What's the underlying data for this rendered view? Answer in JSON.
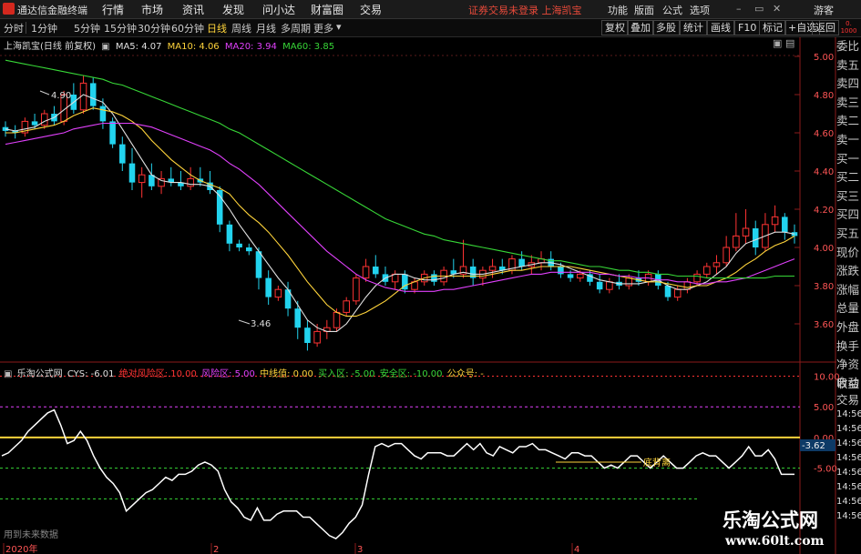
{
  "window": {
    "title": "通达信金融终端"
  },
  "menu": [
    "行情",
    "市场",
    "资讯",
    "发现",
    "问小达",
    "财富圈",
    "交易"
  ],
  "notice": "证券交易未登录  上海凯宝",
  "right_menu": [
    "功能",
    "版面",
    "公式",
    "选项",
    "游客"
  ],
  "toolbar": {
    "periods": [
      "分时",
      "1分钟",
      "5分钟",
      "15分钟",
      "30分钟",
      "60分钟",
      "日线",
      "周线",
      "月线",
      "多周期",
      "更多"
    ],
    "active": "日线",
    "buttons": [
      "复权",
      "叠加",
      "多股",
      "统计",
      "画线",
      "F10",
      "标记",
      "+自选",
      "返回"
    ]
  },
  "main_chart": {
    "title": "上海凯宝(日线 前复权)",
    "ma": [
      {
        "label": "MA5: 4.07",
        "color": "#e0e0e0"
      },
      {
        "label": "MA10: 4.06",
        "color": "#ffd43b"
      },
      {
        "label": "MA20: 3.94",
        "color": "#e040fb"
      },
      {
        "label": "MA60: 3.85",
        "color": "#37d637"
      }
    ],
    "price_labels": [
      "5.00",
      "4.80",
      "4.60",
      "4.40",
      "4.20",
      "4.00",
      "3.80",
      "3.60"
    ],
    "max_marker": "4.90",
    "min_marker": "3.46"
  },
  "indicator": {
    "title": "乐淘公式网",
    "items": [
      {
        "label": "CYS: -6.01",
        "color": "#e0e0e0"
      },
      {
        "label": "绝对风险区: 10.00",
        "color": "#ff3333"
      },
      {
        "label": "风险区: 5.00",
        "color": "#e040fb"
      },
      {
        "label": "中线值: 0.00",
        "color": "#ffd43b"
      },
      {
        "label": "买入区: -5.00",
        "color": "#37d637"
      },
      {
        "label": "安全区: -10.00",
        "color": "#37d637"
      },
      {
        "label": "公众号: -",
        "color": "#ffd43b"
      }
    ],
    "axis_labels": [
      "10.00",
      "5.00",
      "0.00",
      "-5.00"
    ],
    "current": "-3.62",
    "annotation": "底背离",
    "footer": "用到未来数据"
  },
  "date_axis": [
    "2020年",
    "2",
    "3",
    "4"
  ],
  "side_column": [
    "委比",
    "卖五",
    "卖四",
    "卖三",
    "卖二",
    "卖一",
    "买一",
    "买二",
    "买三",
    "买四",
    "买五",
    "现价",
    "涨跌",
    "涨幅",
    "总量",
    "外盘",
    "换手",
    "净资",
    "收益"
  ],
  "side_column_lower": [
    "自动",
    "交易"
  ],
  "time_labels": [
    "14:56",
    "14:56",
    "14:56",
    "14:56",
    "14:56",
    "14:56",
    "14:56",
    "14:56"
  ],
  "watermark": {
    "line1": "乐淘公式网",
    "line2": "www.60lt.com"
  },
  "colors": {
    "up": "#ff3333",
    "down": "#22d3ee",
    "background": "#000000"
  },
  "chart_data": {
    "type": "candlestick",
    "yrange": [
      3.4,
      5.1
    ],
    "candles": [
      [
        4.63,
        4.66,
        4.58,
        4.61
      ],
      [
        4.61,
        4.64,
        4.57,
        4.6
      ],
      [
        4.6,
        4.68,
        4.58,
        4.66
      ],
      [
        4.66,
        4.7,
        4.62,
        4.64
      ],
      [
        4.64,
        4.72,
        4.62,
        4.7
      ],
      [
        4.7,
        4.74,
        4.64,
        4.66
      ],
      [
        4.66,
        4.82,
        4.64,
        4.8
      ],
      [
        4.8,
        4.86,
        4.7,
        4.72
      ],
      [
        4.72,
        4.9,
        4.7,
        4.86
      ],
      [
        4.86,
        4.89,
        4.72,
        4.74
      ],
      [
        4.74,
        4.78,
        4.62,
        4.66
      ],
      [
        4.66,
        4.68,
        4.52,
        4.54
      ],
      [
        4.54,
        4.58,
        4.4,
        4.44
      ],
      [
        4.44,
        4.52,
        4.3,
        4.34
      ],
      [
        4.34,
        4.42,
        4.26,
        4.38
      ],
      [
        4.38,
        4.44,
        4.3,
        4.32
      ],
      [
        4.32,
        4.4,
        4.28,
        4.36
      ],
      [
        4.36,
        4.42,
        4.32,
        4.34
      ],
      [
        4.34,
        4.4,
        4.3,
        4.32
      ],
      [
        4.32,
        4.42,
        4.3,
        4.36
      ],
      [
        4.36,
        4.42,
        4.32,
        4.34
      ],
      [
        4.34,
        4.4,
        4.28,
        4.3
      ],
      [
        4.3,
        4.32,
        4.08,
        4.12
      ],
      [
        4.12,
        4.14,
        3.98,
        4.02
      ],
      [
        4.02,
        4.04,
        3.98,
        4.0
      ],
      [
        4.0,
        4.02,
        3.96,
        3.98
      ],
      [
        3.98,
        4.0,
        3.78,
        3.84
      ],
      [
        3.84,
        3.88,
        3.7,
        3.74
      ],
      [
        3.74,
        3.8,
        3.72,
        3.78
      ],
      [
        3.78,
        3.82,
        3.64,
        3.68
      ],
      [
        3.68,
        3.72,
        3.52,
        3.58
      ],
      [
        3.58,
        3.62,
        3.46,
        3.5
      ],
      [
        3.5,
        3.6,
        3.48,
        3.56
      ],
      [
        3.56,
        3.62,
        3.52,
        3.58
      ],
      [
        3.58,
        3.68,
        3.56,
        3.66
      ],
      [
        3.66,
        3.74,
        3.64,
        3.72
      ],
      [
        3.72,
        3.86,
        3.7,
        3.84
      ],
      [
        3.84,
        3.94,
        3.82,
        3.9
      ],
      [
        3.9,
        3.96,
        3.84,
        3.86
      ],
      [
        3.86,
        3.9,
        3.8,
        3.82
      ],
      [
        3.82,
        3.88,
        3.78,
        3.86
      ],
      [
        3.86,
        3.88,
        3.76,
        3.78
      ],
      [
        3.78,
        3.84,
        3.76,
        3.82
      ],
      [
        3.82,
        3.88,
        3.8,
        3.86
      ],
      [
        3.86,
        3.88,
        3.8,
        3.82
      ],
      [
        3.82,
        3.9,
        3.8,
        3.88
      ],
      [
        3.88,
        3.94,
        3.84,
        3.86
      ],
      [
        3.86,
        4.04,
        3.84,
        3.9
      ],
      [
        3.9,
        3.94,
        3.8,
        3.84
      ],
      [
        3.84,
        3.9,
        3.8,
        3.88
      ],
      [
        3.88,
        3.94,
        3.84,
        3.9
      ],
      [
        3.9,
        3.94,
        3.86,
        3.88
      ],
      [
        3.88,
        3.96,
        3.86,
        3.94
      ],
      [
        3.94,
        3.98,
        3.88,
        3.9
      ],
      [
        3.9,
        3.96,
        3.86,
        3.92
      ],
      [
        3.92,
        3.98,
        3.88,
        3.94
      ],
      [
        3.94,
        3.98,
        3.88,
        3.9
      ],
      [
        3.9,
        3.92,
        3.84,
        3.86
      ],
      [
        3.86,
        3.88,
        3.82,
        3.84
      ],
      [
        3.84,
        3.88,
        3.82,
        3.86
      ],
      [
        3.86,
        3.88,
        3.8,
        3.82
      ],
      [
        3.82,
        3.86,
        3.76,
        3.78
      ],
      [
        3.78,
        3.84,
        3.76,
        3.82
      ],
      [
        3.82,
        3.86,
        3.78,
        3.8
      ],
      [
        3.8,
        3.86,
        3.78,
        3.84
      ],
      [
        3.84,
        3.88,
        3.8,
        3.82
      ],
      [
        3.82,
        3.88,
        3.8,
        3.86
      ],
      [
        3.86,
        3.88,
        3.78,
        3.8
      ],
      [
        3.8,
        3.82,
        3.72,
        3.74
      ],
      [
        3.74,
        3.8,
        3.72,
        3.78
      ],
      [
        3.78,
        3.84,
        3.76,
        3.82
      ],
      [
        3.82,
        3.88,
        3.8,
        3.86
      ],
      [
        3.86,
        3.92,
        3.84,
        3.9
      ],
      [
        3.9,
        3.96,
        3.86,
        3.92
      ],
      [
        3.92,
        4.06,
        3.9,
        4.0
      ],
      [
        4.0,
        4.18,
        3.98,
        4.06
      ],
      [
        4.06,
        4.2,
        4.02,
        4.1
      ],
      [
        4.1,
        4.14,
        3.96,
        4.0
      ],
      [
        4.0,
        4.18,
        3.98,
        4.12
      ],
      [
        4.12,
        4.22,
        4.08,
        4.16
      ],
      [
        4.16,
        4.18,
        4.04,
        4.08
      ],
      [
        4.08,
        4.12,
        4.02,
        4.06
      ]
    ],
    "ma5": [
      4.62,
      4.61,
      4.62,
      4.63,
      4.66,
      4.68,
      4.72,
      4.76,
      4.8,
      4.78,
      4.76,
      4.7,
      4.62,
      4.54,
      4.46,
      4.38,
      4.35,
      4.34,
      4.34,
      4.33,
      4.33,
      4.32,
      4.27,
      4.2,
      4.12,
      4.05,
      3.98,
      3.91,
      3.84,
      3.78,
      3.7,
      3.62,
      3.58,
      3.56,
      3.56,
      3.6,
      3.67,
      3.74,
      3.8,
      3.84,
      3.86,
      3.86,
      3.84,
      3.83,
      3.83,
      3.84,
      3.86,
      3.87,
      3.86,
      3.86,
      3.87,
      3.88,
      3.89,
      3.9,
      3.91,
      3.92,
      3.92,
      3.91,
      3.89,
      3.87,
      3.85,
      3.83,
      3.82,
      3.81,
      3.81,
      3.81,
      3.82,
      3.83,
      3.8,
      3.78,
      3.78,
      3.8,
      3.82,
      3.86,
      3.9,
      3.97,
      4.02,
      4.04,
      4.06,
      4.08,
      4.08,
      4.07
    ],
    "ma10": [
      4.6,
      4.6,
      4.61,
      4.62,
      4.63,
      4.64,
      4.66,
      4.69,
      4.71,
      4.73,
      4.72,
      4.71,
      4.69,
      4.66,
      4.62,
      4.56,
      4.51,
      4.46,
      4.42,
      4.38,
      4.35,
      4.33,
      4.31,
      4.28,
      4.22,
      4.17,
      4.13,
      4.08,
      4.02,
      3.96,
      3.89,
      3.82,
      3.76,
      3.7,
      3.66,
      3.64,
      3.64,
      3.66,
      3.69,
      3.72,
      3.76,
      3.8,
      3.82,
      3.84,
      3.85,
      3.85,
      3.85,
      3.85,
      3.85,
      3.85,
      3.86,
      3.87,
      3.88,
      3.88,
      3.89,
      3.9,
      3.9,
      3.9,
      3.9,
      3.89,
      3.88,
      3.87,
      3.86,
      3.85,
      3.84,
      3.83,
      3.82,
      3.82,
      3.81,
      3.8,
      3.79,
      3.8,
      3.8,
      3.82,
      3.84,
      3.87,
      3.91,
      3.94,
      3.98,
      4.01,
      4.03,
      4.06
    ],
    "ma20": [
      4.54,
      4.55,
      4.56,
      4.57,
      4.58,
      4.59,
      4.6,
      4.62,
      4.63,
      4.64,
      4.65,
      4.65,
      4.65,
      4.65,
      4.64,
      4.63,
      4.61,
      4.59,
      4.57,
      4.55,
      4.53,
      4.51,
      4.48,
      4.44,
      4.41,
      4.37,
      4.33,
      4.28,
      4.23,
      4.18,
      4.13,
      4.08,
      4.03,
      3.98,
      3.94,
      3.9,
      3.86,
      3.83,
      3.81,
      3.79,
      3.78,
      3.77,
      3.77,
      3.77,
      3.77,
      3.78,
      3.78,
      3.79,
      3.8,
      3.81,
      3.82,
      3.83,
      3.84,
      3.85,
      3.86,
      3.86,
      3.87,
      3.87,
      3.87,
      3.87,
      3.87,
      3.86,
      3.86,
      3.85,
      3.85,
      3.84,
      3.84,
      3.83,
      3.83,
      3.82,
      3.82,
      3.81,
      3.81,
      3.82,
      3.82,
      3.83,
      3.84,
      3.86,
      3.88,
      3.9,
      3.92,
      3.94
    ],
    "ma60": [
      4.98,
      4.97,
      4.96,
      4.95,
      4.94,
      4.93,
      4.92,
      4.91,
      4.9,
      4.89,
      4.88,
      4.86,
      4.85,
      4.83,
      4.81,
      4.79,
      4.77,
      4.75,
      4.73,
      4.71,
      4.69,
      4.67,
      4.65,
      4.62,
      4.6,
      4.57,
      4.54,
      4.51,
      4.48,
      4.45,
      4.42,
      4.39,
      4.36,
      4.33,
      4.3,
      4.27,
      4.24,
      4.21,
      4.18,
      4.15,
      4.13,
      4.11,
      4.09,
      4.07,
      4.06,
      4.04,
      4.03,
      4.02,
      4.01,
      4.0,
      3.99,
      3.98,
      3.97,
      3.96,
      3.95,
      3.94,
      3.93,
      3.93,
      3.92,
      3.91,
      3.9,
      3.9,
      3.89,
      3.88,
      3.88,
      3.87,
      3.87,
      3.86,
      3.86,
      3.85,
      3.85,
      3.85,
      3.84,
      3.84,
      3.84,
      3.84,
      3.84,
      3.84,
      3.84,
      3.85,
      3.85,
      3.85
    ],
    "indicator_range": [
      -19,
      12
    ],
    "cys": [
      -3,
      -2.5,
      -1.5,
      -0.5,
      1,
      2,
      3,
      4,
      4.5,
      2,
      -1,
      -0.5,
      1,
      -0.5,
      -3,
      -5,
      -6.5,
      -7.5,
      -9,
      -12,
      -11,
      -10,
      -9,
      -8.5,
      -7.5,
      -6.5,
      -7,
      -6,
      -6,
      -5.5,
      -4.5,
      -4,
      -4.5,
      -5.5,
      -8.5,
      -10.5,
      -11.5,
      -13,
      -13.5,
      -11.5,
      -13.5,
      -13.5,
      -12.5,
      -12,
      -12,
      -12,
      -13,
      -13,
      -14,
      -15,
      -16,
      -16.5,
      -15.5,
      -14,
      -13,
      -11,
      -6,
      -1.5,
      -1,
      -1.5,
      -1,
      -1,
      -2,
      -3,
      -3.5,
      -2.5,
      -2.5,
      -2.5,
      -3,
      -3,
      -2,
      -1,
      -2,
      -1,
      -2.5,
      -3,
      -1.5,
      -2,
      -2.5,
      -1.5,
      -1.5,
      -1,
      -2,
      -2,
      -2.5,
      -3,
      -3.5,
      -2.5,
      -2.5,
      -3,
      -3,
      -4,
      -5,
      -4.5,
      -5,
      -4,
      -3,
      -3,
      -4,
      -5,
      -4,
      -3,
      -4,
      -5,
      -5,
      -4,
      -3,
      -2.5,
      -3,
      -3,
      -4,
      -5,
      -4,
      -3,
      -1.5,
      -3,
      -3,
      -2,
      -3.5,
      -6,
      -6,
      -6
    ]
  }
}
